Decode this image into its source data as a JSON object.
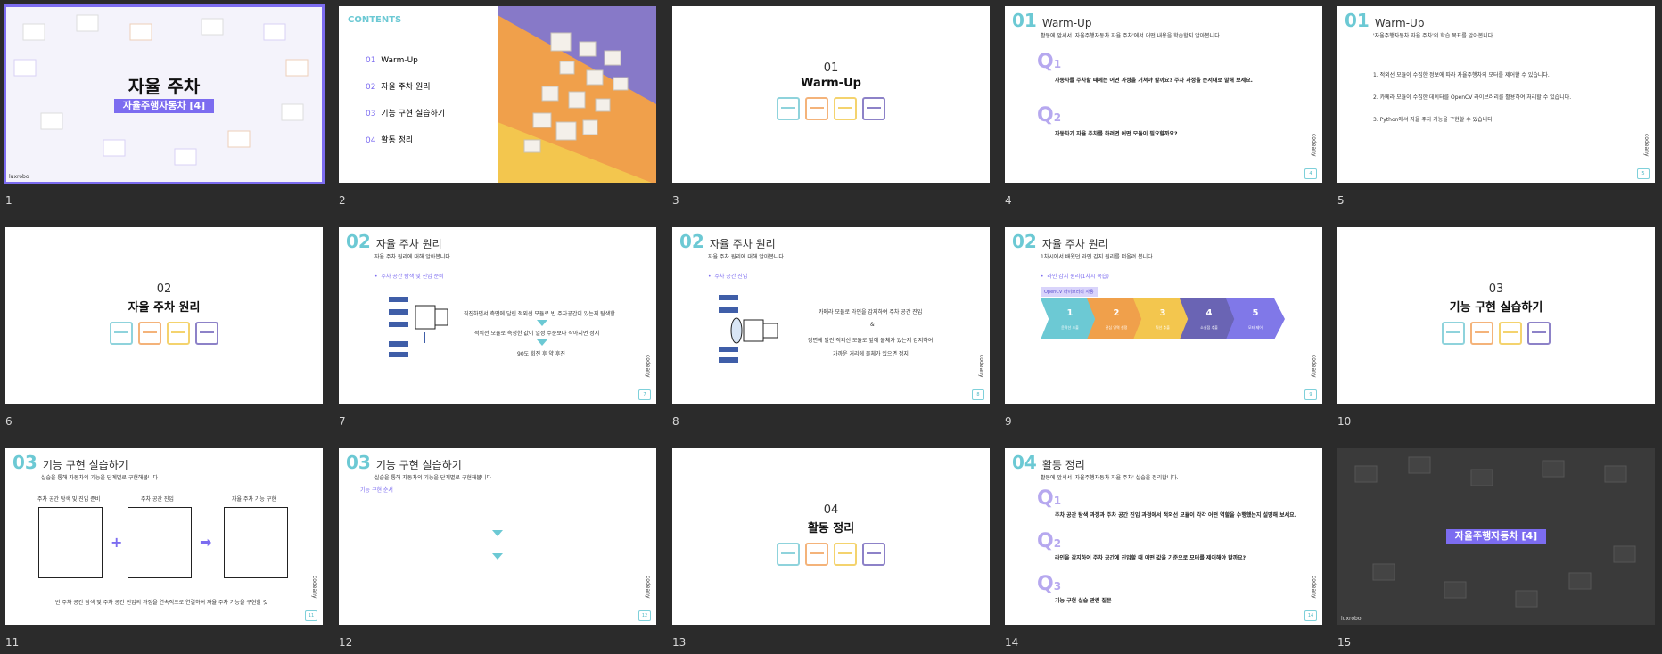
{
  "brand": {
    "logo_text": "luxrobo",
    "side_logo": "codeany"
  },
  "colors": {
    "accent": "#7c6cf0",
    "teal": "#6cc9d4",
    "dark_bg": "#2b2b2b"
  },
  "slides": [
    {
      "num": "1",
      "title": "자율 주차",
      "subtitle": "자율주행자동차 [4]"
    },
    {
      "num": "2",
      "contents_label": "CONTENTS",
      "items": [
        {
          "n": "01",
          "t": "Warm-Up"
        },
        {
          "n": "02",
          "t": "자율 주차 원리"
        },
        {
          "n": "03",
          "t": "기능 구현 실습하기"
        },
        {
          "n": "04",
          "t": "활동 정리"
        }
      ]
    },
    {
      "num": "3",
      "sec_num": "01",
      "sec_title": "Warm-Up"
    },
    {
      "num": "4",
      "big": "01",
      "title": "Warm-Up",
      "sub": "활동에 앞서서 '자율주행자동차 자율 주차'에서 어떤 내용을 학습할지 알아봅니다",
      "q1": "자동차를 주차할 때에는 어떤 과정을 거쳐야 할까요? 주차 과정을 순서대로 말해 보세요.",
      "q2": "자동차가 자율 주차를 하려면 어떤 모듈이 필요할까요?"
    },
    {
      "num": "5",
      "big": "01",
      "title": "Warm-Up",
      "sub": "'자율주행자동차 자율 주차'의 학습 목표를 알아봅니다",
      "goals": [
        "1.  적외선 모듈이 수집한 정보에 따라 자율주행차의 모터를 제어할 수 있습니다.",
        "2.  카메라 모듈이 수집한 데이터를 OpenCV 라이브러리를 활용하여 처리할 수 있습니다.",
        "3.  Python에서 자율 주차 기능을 구현할 수 있습니다."
      ]
    },
    {
      "num": "6",
      "sec_num": "02",
      "sec_title": "자율 주차 원리"
    },
    {
      "num": "7",
      "big": "02",
      "title": "자율 주차 원리",
      "sub": "자율 주차 원리에 대해 알아봅니다.",
      "bullet": "주차 공간 탐색 및 진입 준비",
      "steps": [
        "직진하면서 측면에 달린 적외선 모듈로 빈 주차공간이 있는지 탐색함",
        "적외선 모듈로 측정한 값이 일정 수준보다 작아지면 정지",
        "90도 회전 후 약 후진"
      ]
    },
    {
      "num": "8",
      "big": "02",
      "title": "자율 주차 원리",
      "sub": "자율 주차 원리에 대해 알아봅니다.",
      "bullet": "주차 공간 진입",
      "steps": [
        "카메라 모듈로 라인을 감지하여 주차 공간 진입",
        "&",
        "정면에 달린 적외선 모듈로 앞에 물체가 있는지 감지하여",
        "가까운 거리에 물체가 있으면 정지"
      ]
    },
    {
      "num": "9",
      "big": "02",
      "title": "자율 주차 원리",
      "sub": "1차시에서 배웠던 라인 감지 원리를 떠올려 봅니다.",
      "bullet": "라인 감지 원리(1차시 복습)",
      "tag": "OpenCV 라이브러리 사용",
      "arrows": [
        {
          "n": "1",
          "label": "윤곽선 추출",
          "color": "#6cc9d4"
        },
        {
          "n": "2",
          "label": "관심 영역 설정",
          "color": "#f0a04b"
        },
        {
          "n": "3",
          "label": "직선 추출",
          "color": "#f3c64e"
        },
        {
          "n": "4",
          "label": "소실점 추출",
          "color": "#6a64b4"
        },
        {
          "n": "5",
          "label": "모터 제어",
          "color": "#8078e8"
        }
      ]
    },
    {
      "num": "10",
      "sec_num": "03",
      "sec_title": "기능 구현 실습하기"
    },
    {
      "num": "11",
      "big": "03",
      "title": "기능 구현 실습하기",
      "sub": "실습을 통해 자동차의 기능을 단계별로 구현해봅니다",
      "cols": [
        "주차 공간 탐색 및 진입 준비",
        "주차 공간 진입",
        "자율 주차 기능 구현"
      ],
      "footer": "빈 주차 공간 탐색 및 주차 공간 진입의 과정을 연속적으로 연결하여 자율 주차 기능을 구현할 것"
    },
    {
      "num": "12",
      "big": "03",
      "title": "기능 구현 실습하기",
      "sub": "실습을 통해 자동차의 기능을 단계별로 구현해봅니다",
      "bullet": "기능 구현 순서"
    },
    {
      "num": "13",
      "sec_num": "04",
      "sec_title": "활동 정리"
    },
    {
      "num": "14",
      "big": "04",
      "title": "활동 정리",
      "sub": "활동에 앞서서 '자율주행자동차 자율 주차' 실습을 정리합니다.",
      "q1": "주차 공간 탐색 과정과 주차 공간 진입 과정에서 적외선 모듈이 각각 어떤 역할을 수행했는지 설명해 보세요.",
      "q2": "라인을 감지하여 주차 공간에 진입할 때 어떤 값을 기준으로 모터를 제어해야 할까요?",
      "q3": "기능 구현 실습 관련 질문"
    },
    {
      "num": "15",
      "subtitle": "자율주행자동차 [4]"
    }
  ]
}
